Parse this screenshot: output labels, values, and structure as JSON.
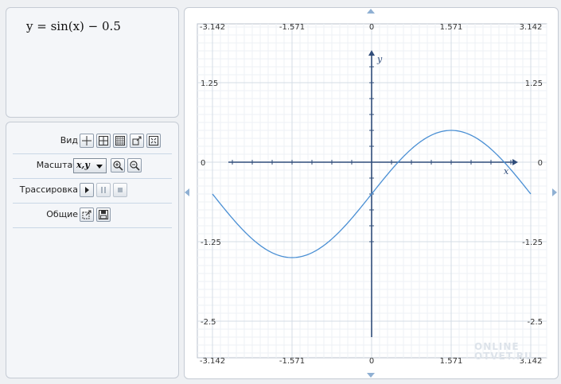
{
  "formula": "y = sin(x) − 0.5",
  "controls": {
    "view_label": "Вид",
    "scale_label": "Масштаб",
    "scale_value": "x,y",
    "trace_label": "Трассировка",
    "general_label": "Общие"
  },
  "icons": {
    "view": [
      "axes-icon",
      "frame-icon",
      "grid-icon",
      "zoom-rect-icon",
      "fit-icon"
    ],
    "scale": [
      "zoom-in-icon",
      "zoom-out-icon"
    ],
    "trace": [
      "play-icon",
      "pause-icon",
      "stop-icon"
    ],
    "general": [
      "export-icon",
      "save-icon"
    ]
  },
  "colors": {
    "curve": "#4a8fd4",
    "axis": "#2f4c7a",
    "grid_major": "#d4dce6",
    "grid_minor": "#edf1f5"
  },
  "chart_data": {
    "type": "line",
    "function": "sin(x) - 0.5",
    "xlabel": "x",
    "ylabel": "y",
    "xlim": [
      -3.142,
      3.142
    ],
    "ylim": [
      -2.5,
      1.25
    ],
    "x_ticks": [
      "-3.142",
      "-1.571",
      "0",
      "1.571",
      "3.142"
    ],
    "y_ticks": [
      "1.25",
      "0",
      "-1.25",
      "-2.5"
    ],
    "series": [
      {
        "x": [
          -3.142,
          -2.356,
          -1.571,
          -0.785,
          0,
          0.524,
          0.785,
          1.571,
          2.356,
          2.618,
          3.142
        ],
        "y": [
          -0.5,
          -1.207,
          -1.5,
          -1.207,
          -0.5,
          0,
          0.207,
          0.5,
          0.207,
          0,
          -0.5
        ]
      }
    ]
  },
  "watermark": [
    "ONLINE",
    "OTVET.RU"
  ]
}
